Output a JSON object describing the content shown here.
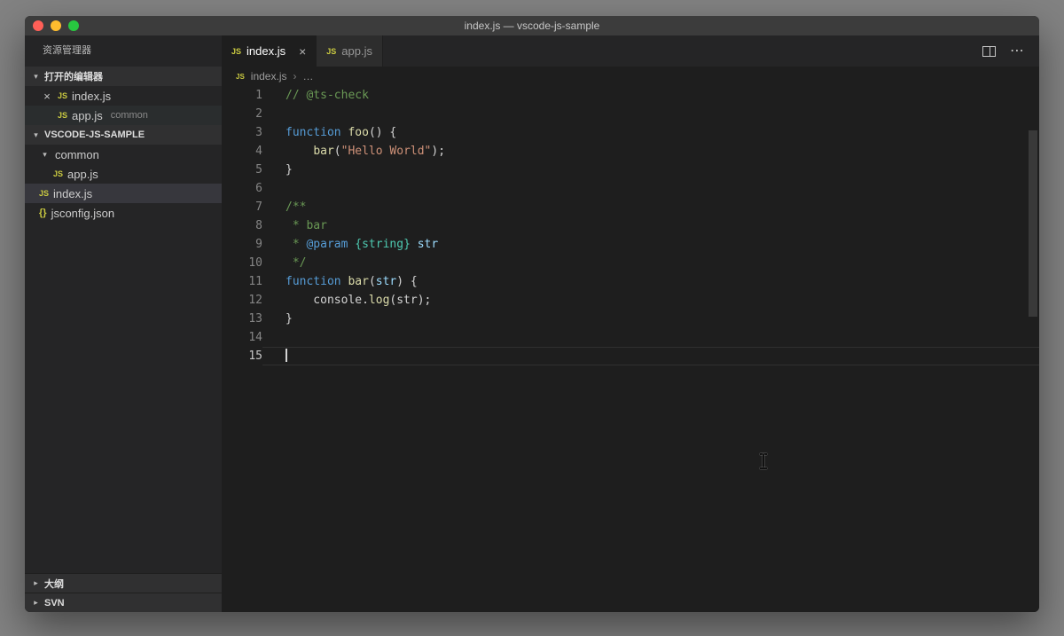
{
  "window": {
    "title": "index.js — vscode-js-sample"
  },
  "colors": {
    "backdrop": "#828282",
    "titlebar": "#3c3c3c",
    "sidebar": "#252526",
    "editor_bg": "#1e1e1e",
    "selection_row": "#37373d",
    "comment": "#6A9955",
    "keyword": "#569CD6",
    "function": "#DCDCAA",
    "string": "#CE9178",
    "type": "#4EC9B0",
    "parameter": "#9CDCFE",
    "js_icon": "#cbcb41"
  },
  "icons": {
    "js_badge": "JS",
    "json_badge": "{}",
    "chevron_down": "▾",
    "chevron_right": "▸",
    "more_actions": "⋯",
    "crumb_separator": "›"
  },
  "sidebar": {
    "title": "资源管理器",
    "open_editors": {
      "label": "打开的编辑器",
      "items": [
        {
          "icon": "js",
          "label": "index.js",
          "close": "×",
          "detail": "",
          "highlight": false
        },
        {
          "icon": "js",
          "label": "app.js",
          "close": "",
          "detail": "common",
          "highlight": true
        }
      ]
    },
    "workspace": {
      "label": "VSCODE-JS-SAMPLE",
      "items": [
        {
          "kind": "folder",
          "label": "common",
          "indent": 0,
          "expanded": true
        },
        {
          "kind": "file",
          "icon": "js",
          "label": "app.js",
          "indent": 1
        },
        {
          "kind": "file",
          "icon": "js",
          "label": "index.js",
          "indent": 0,
          "selected": true
        },
        {
          "kind": "file",
          "icon": "json",
          "label": "jsconfig.json",
          "indent": 0
        }
      ]
    },
    "bottom_sections": [
      {
        "label": "大纲"
      },
      {
        "label": "SVN"
      }
    ]
  },
  "editor": {
    "tabs": [
      {
        "icon": "js",
        "label": "index.js",
        "active": true,
        "close": "×"
      },
      {
        "icon": "js",
        "label": "app.js",
        "active": false,
        "close": ""
      }
    ],
    "breadcrumb": {
      "file": "index.js",
      "separator": "›",
      "more": "…"
    },
    "code": {
      "cursor_line": 15,
      "lines": [
        [
          {
            "t": "// @ts-check",
            "c": "comment"
          }
        ],
        [],
        [
          {
            "t": "function",
            "c": "keyword"
          },
          {
            "t": " ",
            "c": "plain"
          },
          {
            "t": "foo",
            "c": "func"
          },
          {
            "t": "() {",
            "c": "plain"
          }
        ],
        [
          {
            "t": "    ",
            "c": "plain"
          },
          {
            "t": "bar",
            "c": "func"
          },
          {
            "t": "(",
            "c": "plain"
          },
          {
            "t": "\"Hello World\"",
            "c": "string"
          },
          {
            "t": ");",
            "c": "plain"
          }
        ],
        [
          {
            "t": "}",
            "c": "plain"
          }
        ],
        [],
        [
          {
            "t": "/**",
            "c": "comment"
          }
        ],
        [
          {
            "t": " * bar",
            "c": "comment"
          }
        ],
        [
          {
            "t": " * ",
            "c": "comment"
          },
          {
            "t": "@param",
            "c": "dockeyword"
          },
          {
            "t": " ",
            "c": "plain"
          },
          {
            "t": "{string}",
            "c": "type"
          },
          {
            "t": " ",
            "c": "plain"
          },
          {
            "t": "str",
            "c": "docparam"
          }
        ],
        [
          {
            "t": " */",
            "c": "comment"
          }
        ],
        [
          {
            "t": "function",
            "c": "keyword"
          },
          {
            "t": " ",
            "c": "plain"
          },
          {
            "t": "bar",
            "c": "func"
          },
          {
            "t": "(",
            "c": "plain"
          },
          {
            "t": "str",
            "c": "param"
          },
          {
            "t": ") {",
            "c": "plain"
          }
        ],
        [
          {
            "t": "    console.",
            "c": "plain"
          },
          {
            "t": "log",
            "c": "func"
          },
          {
            "t": "(str);",
            "c": "plain"
          }
        ],
        [
          {
            "t": "}",
            "c": "plain"
          }
        ],
        [],
        []
      ]
    }
  }
}
